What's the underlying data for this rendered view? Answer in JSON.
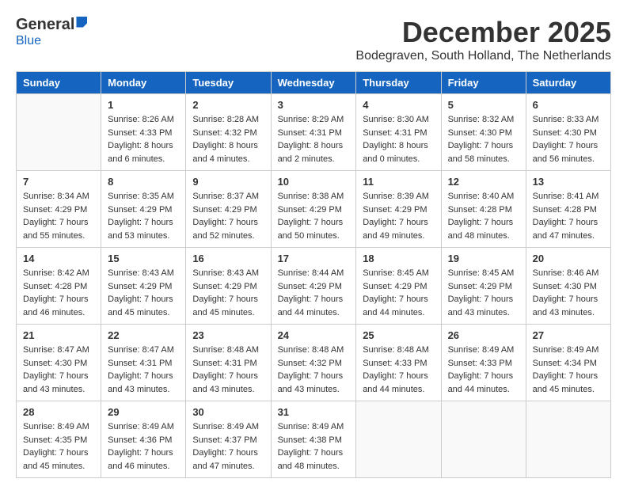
{
  "logo": {
    "general": "General",
    "blue": "Blue"
  },
  "title": "December 2025",
  "subtitle": "Bodegraven, South Holland, The Netherlands",
  "weekdays": [
    "Sunday",
    "Monday",
    "Tuesday",
    "Wednesday",
    "Thursday",
    "Friday",
    "Saturday"
  ],
  "weeks": [
    [
      {
        "day": "",
        "sunrise": "",
        "sunset": "",
        "daylight": "",
        "empty": true
      },
      {
        "day": "1",
        "sunrise": "Sunrise: 8:26 AM",
        "sunset": "Sunset: 4:33 PM",
        "daylight": "Daylight: 8 hours and 6 minutes."
      },
      {
        "day": "2",
        "sunrise": "Sunrise: 8:28 AM",
        "sunset": "Sunset: 4:32 PM",
        "daylight": "Daylight: 8 hours and 4 minutes."
      },
      {
        "day": "3",
        "sunrise": "Sunrise: 8:29 AM",
        "sunset": "Sunset: 4:31 PM",
        "daylight": "Daylight: 8 hours and 2 minutes."
      },
      {
        "day": "4",
        "sunrise": "Sunrise: 8:30 AM",
        "sunset": "Sunset: 4:31 PM",
        "daylight": "Daylight: 8 hours and 0 minutes."
      },
      {
        "day": "5",
        "sunrise": "Sunrise: 8:32 AM",
        "sunset": "Sunset: 4:30 PM",
        "daylight": "Daylight: 7 hours and 58 minutes."
      },
      {
        "day": "6",
        "sunrise": "Sunrise: 8:33 AM",
        "sunset": "Sunset: 4:30 PM",
        "daylight": "Daylight: 7 hours and 56 minutes."
      }
    ],
    [
      {
        "day": "7",
        "sunrise": "Sunrise: 8:34 AM",
        "sunset": "Sunset: 4:29 PM",
        "daylight": "Daylight: 7 hours and 55 minutes."
      },
      {
        "day": "8",
        "sunrise": "Sunrise: 8:35 AM",
        "sunset": "Sunset: 4:29 PM",
        "daylight": "Daylight: 7 hours and 53 minutes."
      },
      {
        "day": "9",
        "sunrise": "Sunrise: 8:37 AM",
        "sunset": "Sunset: 4:29 PM",
        "daylight": "Daylight: 7 hours and 52 minutes."
      },
      {
        "day": "10",
        "sunrise": "Sunrise: 8:38 AM",
        "sunset": "Sunset: 4:29 PM",
        "daylight": "Daylight: 7 hours and 50 minutes."
      },
      {
        "day": "11",
        "sunrise": "Sunrise: 8:39 AM",
        "sunset": "Sunset: 4:29 PM",
        "daylight": "Daylight: 7 hours and 49 minutes."
      },
      {
        "day": "12",
        "sunrise": "Sunrise: 8:40 AM",
        "sunset": "Sunset: 4:28 PM",
        "daylight": "Daylight: 7 hours and 48 minutes."
      },
      {
        "day": "13",
        "sunrise": "Sunrise: 8:41 AM",
        "sunset": "Sunset: 4:28 PM",
        "daylight": "Daylight: 7 hours and 47 minutes."
      }
    ],
    [
      {
        "day": "14",
        "sunrise": "Sunrise: 8:42 AM",
        "sunset": "Sunset: 4:28 PM",
        "daylight": "Daylight: 7 hours and 46 minutes."
      },
      {
        "day": "15",
        "sunrise": "Sunrise: 8:43 AM",
        "sunset": "Sunset: 4:29 PM",
        "daylight": "Daylight: 7 hours and 45 minutes."
      },
      {
        "day": "16",
        "sunrise": "Sunrise: 8:43 AM",
        "sunset": "Sunset: 4:29 PM",
        "daylight": "Daylight: 7 hours and 45 minutes."
      },
      {
        "day": "17",
        "sunrise": "Sunrise: 8:44 AM",
        "sunset": "Sunset: 4:29 PM",
        "daylight": "Daylight: 7 hours and 44 minutes."
      },
      {
        "day": "18",
        "sunrise": "Sunrise: 8:45 AM",
        "sunset": "Sunset: 4:29 PM",
        "daylight": "Daylight: 7 hours and 44 minutes."
      },
      {
        "day": "19",
        "sunrise": "Sunrise: 8:45 AM",
        "sunset": "Sunset: 4:29 PM",
        "daylight": "Daylight: 7 hours and 43 minutes."
      },
      {
        "day": "20",
        "sunrise": "Sunrise: 8:46 AM",
        "sunset": "Sunset: 4:30 PM",
        "daylight": "Daylight: 7 hours and 43 minutes."
      }
    ],
    [
      {
        "day": "21",
        "sunrise": "Sunrise: 8:47 AM",
        "sunset": "Sunset: 4:30 PM",
        "daylight": "Daylight: 7 hours and 43 minutes."
      },
      {
        "day": "22",
        "sunrise": "Sunrise: 8:47 AM",
        "sunset": "Sunset: 4:31 PM",
        "daylight": "Daylight: 7 hours and 43 minutes."
      },
      {
        "day": "23",
        "sunrise": "Sunrise: 8:48 AM",
        "sunset": "Sunset: 4:31 PM",
        "daylight": "Daylight: 7 hours and 43 minutes."
      },
      {
        "day": "24",
        "sunrise": "Sunrise: 8:48 AM",
        "sunset": "Sunset: 4:32 PM",
        "daylight": "Daylight: 7 hours and 43 minutes."
      },
      {
        "day": "25",
        "sunrise": "Sunrise: 8:48 AM",
        "sunset": "Sunset: 4:33 PM",
        "daylight": "Daylight: 7 hours and 44 minutes."
      },
      {
        "day": "26",
        "sunrise": "Sunrise: 8:49 AM",
        "sunset": "Sunset: 4:33 PM",
        "daylight": "Daylight: 7 hours and 44 minutes."
      },
      {
        "day": "27",
        "sunrise": "Sunrise: 8:49 AM",
        "sunset": "Sunset: 4:34 PM",
        "daylight": "Daylight: 7 hours and 45 minutes."
      }
    ],
    [
      {
        "day": "28",
        "sunrise": "Sunrise: 8:49 AM",
        "sunset": "Sunset: 4:35 PM",
        "daylight": "Daylight: 7 hours and 45 minutes."
      },
      {
        "day": "29",
        "sunrise": "Sunrise: 8:49 AM",
        "sunset": "Sunset: 4:36 PM",
        "daylight": "Daylight: 7 hours and 46 minutes."
      },
      {
        "day": "30",
        "sunrise": "Sunrise: 8:49 AM",
        "sunset": "Sunset: 4:37 PM",
        "daylight": "Daylight: 7 hours and 47 minutes."
      },
      {
        "day": "31",
        "sunrise": "Sunrise: 8:49 AM",
        "sunset": "Sunset: 4:38 PM",
        "daylight": "Daylight: 7 hours and 48 minutes."
      },
      {
        "day": "",
        "sunrise": "",
        "sunset": "",
        "daylight": "",
        "empty": true
      },
      {
        "day": "",
        "sunrise": "",
        "sunset": "",
        "daylight": "",
        "empty": true
      },
      {
        "day": "",
        "sunrise": "",
        "sunset": "",
        "daylight": "",
        "empty": true
      }
    ]
  ]
}
